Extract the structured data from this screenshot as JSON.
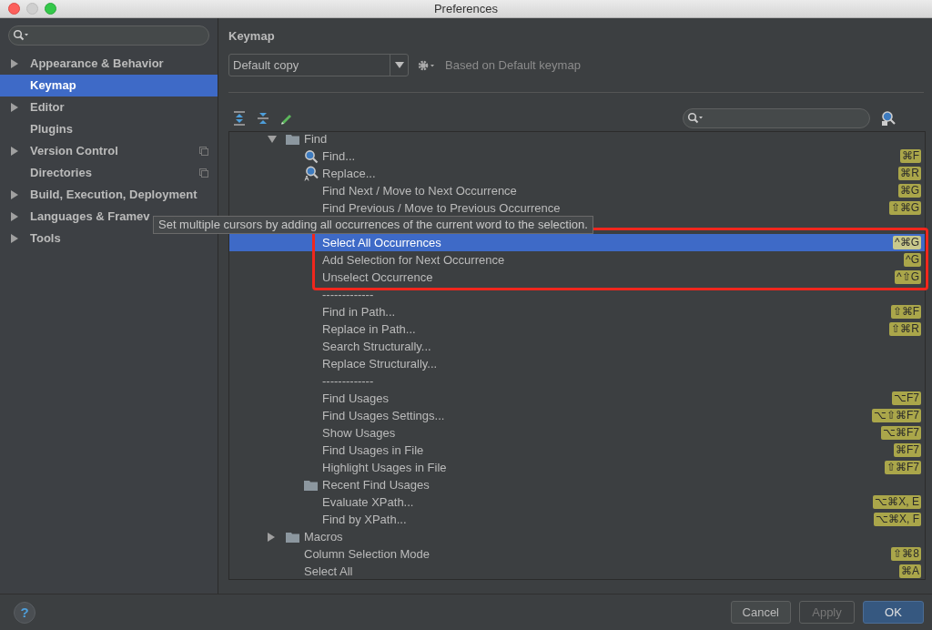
{
  "window": {
    "title": "Preferences"
  },
  "sidebar": {
    "items": [
      {
        "label": "Appearance & Behavior",
        "expandable": true,
        "selected": false,
        "project_level": false
      },
      {
        "label": "Keymap",
        "expandable": false,
        "selected": true,
        "project_level": false
      },
      {
        "label": "Editor",
        "expandable": true,
        "selected": false,
        "project_level": false
      },
      {
        "label": "Plugins",
        "expandable": false,
        "selected": false,
        "project_level": false
      },
      {
        "label": "Version Control",
        "expandable": true,
        "selected": false,
        "project_level": true
      },
      {
        "label": "Directories",
        "expandable": false,
        "selected": false,
        "project_level": true
      },
      {
        "label": "Build, Execution, Deployment",
        "expandable": true,
        "selected": false,
        "project_level": false
      },
      {
        "label": "Languages & Framev",
        "expandable": true,
        "selected": false,
        "project_level": false
      },
      {
        "label": "Tools",
        "expandable": true,
        "selected": false,
        "project_level": false
      }
    ]
  },
  "keymap": {
    "title": "Keymap",
    "scheme": "Default copy",
    "based_on": "Based on Default keymap",
    "tree": [
      {
        "kind": "group",
        "label": "Find",
        "expanded": true,
        "children": [
          {
            "kind": "search",
            "label": "Find...",
            "shortcut": "⌘F",
            "selected": false,
            "highlighted": false
          },
          {
            "kind": "replace",
            "label": "Replace...",
            "shortcut": "⌘R",
            "selected": false,
            "highlighted": false
          },
          {
            "kind": "action",
            "label": "Find Next / Move to Next Occurrence",
            "shortcut": "⌘G",
            "selected": false,
            "highlighted": false
          },
          {
            "kind": "action",
            "label": "Find Previous / Move to Previous Occurrence",
            "shortcut": "⇧⌘G",
            "selected": false,
            "highlighted": false
          },
          {
            "kind": "action",
            "label": "Select All Occurrences",
            "shortcut": "^⌘G",
            "selected": true,
            "highlighted": true,
            "tooltip": "Set multiple cursors by adding all occurrences of the current word to the selection."
          },
          {
            "kind": "action",
            "label": "Add Selection for Next Occurrence",
            "shortcut": "^G",
            "selected": false,
            "highlighted": true
          },
          {
            "kind": "action",
            "label": "Unselect Occurrence",
            "shortcut": "^⇧G",
            "selected": false,
            "highlighted": true
          },
          {
            "kind": "separator",
            "label": "-------------"
          },
          {
            "kind": "action",
            "label": "Find in Path...",
            "shortcut": "⇧⌘F",
            "selected": false,
            "highlighted": false
          },
          {
            "kind": "action",
            "label": "Replace in Path...",
            "shortcut": "⇧⌘R",
            "selected": false,
            "highlighted": false
          },
          {
            "kind": "action",
            "label": "Search Structurally...",
            "selected": false,
            "highlighted": false
          },
          {
            "kind": "action",
            "label": "Replace Structurally...",
            "selected": false,
            "highlighted": false
          },
          {
            "kind": "separator",
            "label": "-------------"
          },
          {
            "kind": "action",
            "label": "Find Usages",
            "shortcut": "⌥F7",
            "selected": false,
            "highlighted": false
          },
          {
            "kind": "action",
            "label": "Find Usages Settings...",
            "shortcut": "⌥⇧⌘F7",
            "selected": false,
            "highlighted": false
          },
          {
            "kind": "action",
            "label": "Show Usages",
            "shortcut": "⌥⌘F7",
            "selected": false,
            "highlighted": false
          },
          {
            "kind": "action",
            "label": "Find Usages in File",
            "shortcut": "⌘F7",
            "selected": false,
            "highlighted": false
          },
          {
            "kind": "action",
            "label": "Highlight Usages in File",
            "shortcut": "⇧⌘F7",
            "selected": false,
            "highlighted": false
          },
          {
            "kind": "folder",
            "label": "Recent Find Usages",
            "selected": false,
            "highlighted": false
          },
          {
            "kind": "action",
            "label": "Evaluate XPath...",
            "shortcut": "⌥⌘X, E",
            "selected": false,
            "highlighted": false
          },
          {
            "kind": "action",
            "label": "Find by XPath...",
            "shortcut": "⌥⌘X, F",
            "selected": false,
            "highlighted": false
          }
        ]
      },
      {
        "kind": "group",
        "label": "Macros",
        "expanded": false
      },
      {
        "kind": "action",
        "label": "Column Selection Mode",
        "shortcut": "⇧⌘8",
        "selected": false,
        "highlighted": false
      },
      {
        "kind": "action",
        "label": "Select All",
        "shortcut": "⌘A",
        "selected": false,
        "highlighted": false
      }
    ]
  },
  "help": {
    "label": "?"
  },
  "buttons": [
    {
      "label": "Cancel",
      "kind": "normal",
      "disabled": false
    },
    {
      "label": "Apply",
      "kind": "normal",
      "disabled": true
    },
    {
      "label": "OK",
      "kind": "default",
      "disabled": false
    }
  ]
}
